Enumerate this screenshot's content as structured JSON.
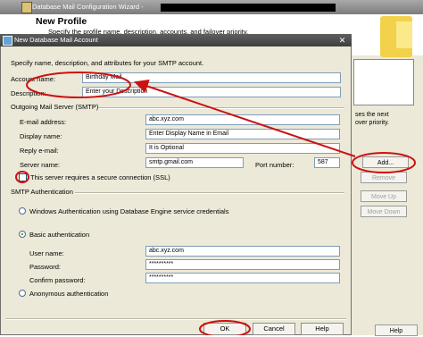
{
  "wizard": {
    "title": "Database Mail Configuration Wizard -",
    "heading": "New Profile",
    "subheading": "Specify the profile name, description, accounts, and failover priority.",
    "right_text": [
      "ses the next",
      "over priority."
    ],
    "buttons": {
      "add": "Add...",
      "remove": "Remove",
      "move_up": "Move Up",
      "move_down": "Move Down",
      "help": "Help"
    }
  },
  "dialog": {
    "title": "New Database Mail Account",
    "intro": "Specify name, description, and attributes for your SMTP account.",
    "account_name_label": "Account name:",
    "account_name_value": "Birthday Mail",
    "description_label": "Description:",
    "description_value": "Enter your Description",
    "smtp_section": "Outgoing Mail Server (SMTP)",
    "email_label": "E-mail address:",
    "email_value": "abc.xyz.com",
    "display_label": "Display name:",
    "display_value": "Enter Display Name in Email",
    "reply_label": "Reply e-mail:",
    "reply_value": "It is Optional",
    "server_label": "Server name:",
    "server_value": "smtp.gmail.com",
    "port_label": "Port number:",
    "port_value": "587",
    "ssl_label": "This server requires a secure connection (SSL)",
    "auth_section": "SMTP Authentication",
    "windows_auth": "Windows Authentication using Database Engine service credentials",
    "basic_auth": "Basic authentication",
    "user_label": "User name:",
    "user_value": "abc.xyz.com",
    "password_label": "Password:",
    "password_value": "**********",
    "confirm_label": "Confirm password:",
    "confirm_value": "**********",
    "anon_auth": "Anonymous authentication",
    "ok": "OK",
    "cancel": "Cancel",
    "help": "Help"
  },
  "colors": {
    "highlight": "#cc1111",
    "title_bar": "#4a4a4a"
  }
}
